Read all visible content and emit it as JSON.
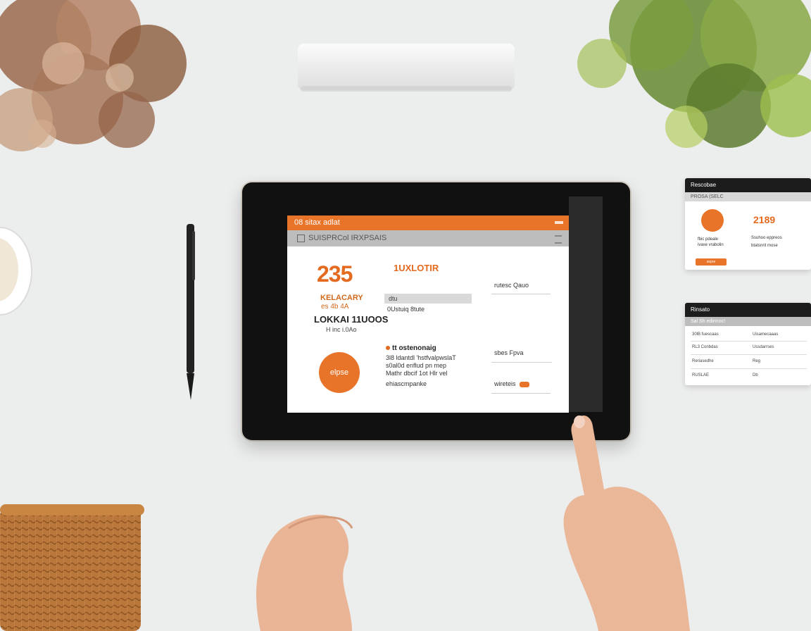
{
  "tablet_app": {
    "header_title": "08 sitax adlat",
    "subheader_title": "SUISPRCol IRXPSAIS",
    "big_number": "235",
    "orange_caption_1": "KELACARY",
    "orange_caption_2": "es 4b 4A",
    "dark_caption": "LOKKAI 11UOOS",
    "small_caption": "H inc i.0Ao",
    "action_button_label": "elpse",
    "column_header": "1UXLOTIR",
    "grey_row_text": "dtu",
    "row_text": "0Ustuiq 8tute",
    "block_heading": "tt ostenonaig",
    "block_line_1": "3l8 ldantdl 'hstfvalpwslaT",
    "block_line_2": "s0al0d enflud pn mep",
    "block_line_3": "Mathr dbcif 1ot Hlr vel",
    "block_line_4": "ehiascmpanke",
    "right_line_1": "rutesc Qauo",
    "right_line_2": "sbes Fpva",
    "right_line_3": "wireteis"
  },
  "card_top": {
    "header": "Rescobae",
    "subheader": "PROSA (SELC",
    "number": "2189",
    "text_left_1": "fbic pdeale",
    "text_left_2": "ivaxe vrabolin",
    "text_right_1": "Ssuhoo eppreos",
    "text_right_2": "btatsnrit mose",
    "button_label": "sepre"
  },
  "card_bottom": {
    "header": "Rinsato",
    "subheader": "Sal Sh edinnoc!",
    "rows_left": [
      "30lB fuescaas",
      "RL3 Conbdas",
      "Reriasedhe",
      "RUSLAE"
    ],
    "rows_right": [
      "Uisamecaaas",
      "Ussdarrses",
      "Reg",
      "Db"
    ]
  },
  "colors": {
    "accent": "#e8742a",
    "tablet_bezel": "#111111",
    "desk": "#eceded"
  },
  "icons": [
    "stylus-pen",
    "hand-pointing",
    "hand-resting",
    "wicker-basket",
    "plant",
    "mug",
    "stone-block"
  ]
}
